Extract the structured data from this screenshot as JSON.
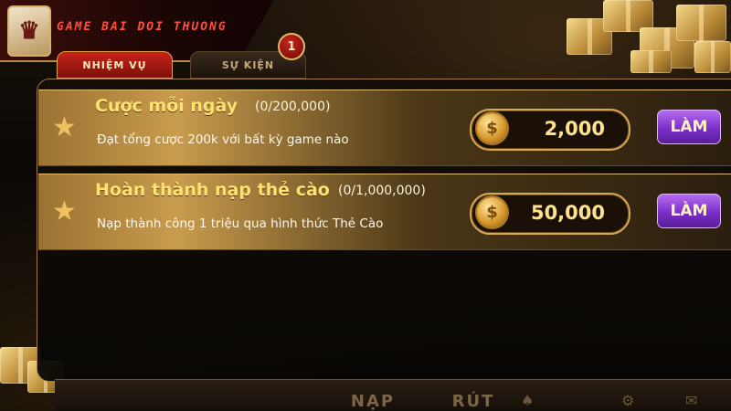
{
  "brand": {
    "logo_text": "GAME BAI DOI THUONG",
    "logo_glyph": "♛",
    "accent": "#ff4f3c"
  },
  "tabs": [
    {
      "label": "NHIỆM VỤ",
      "active": true
    },
    {
      "label": "SỰ KIỆN",
      "active": false
    }
  ],
  "badge": {
    "count": "1"
  },
  "tasks": [
    {
      "title": "Cược mỗi ngày",
      "progress": "(0/200,000)",
      "description": "Đạt tổng cược 200k với bất kỳ game nào",
      "reward": "2,000",
      "button_label": "LÀM",
      "icon": "star-icon"
    },
    {
      "title": "Hoàn thành nạp thẻ cào",
      "progress": "(0/1,000,000)",
      "description": "Nạp thành công 1 triệu qua hình thức Thẻ Cào",
      "reward": "50,000",
      "button_label": "LÀM",
      "icon": "star-icon"
    }
  ],
  "coin_symbol": "$",
  "bottom_nav": [
    {
      "label": "NẠP"
    },
    {
      "label": "RÚT"
    }
  ],
  "colors": {
    "gold": "#ffe270",
    "button_purple": "#7a2fc8",
    "panel_border": "#a17c3c"
  }
}
